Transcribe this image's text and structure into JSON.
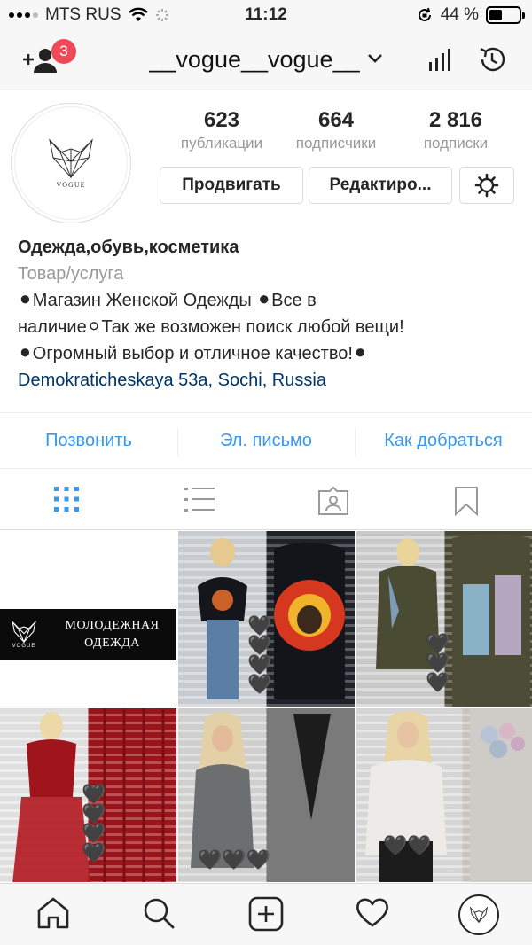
{
  "status_bar": {
    "carrier": "MTS RUS",
    "time": "11:12",
    "battery": "44 %",
    "battery_level": 0.44
  },
  "header": {
    "username": "__vogue__vogue__",
    "follow_badge": "3"
  },
  "profile": {
    "avatar_text": "VOGUE",
    "stats": [
      {
        "value": "623",
        "label": "публикации"
      },
      {
        "value": "664",
        "label": "подписчики"
      },
      {
        "value": "2 816",
        "label": "подписки"
      }
    ],
    "buttons": {
      "promote": "Продвигать",
      "edit": "Редактиро..."
    },
    "bio": {
      "name": "Одежда,обувь,косметика",
      "category": "Товар/услуга",
      "line1": "⚫Магазин Женской Одежды ⚫Все в",
      "line2": "наличие⚪Так же возможен поиск любой вещи!",
      "line3": "⚫Огромный выбор и отличное качество!⚫",
      "location": "Demokraticheskaya 53a, Sochi, Russia"
    }
  },
  "contacts": {
    "call": "Позвонить",
    "email": "Эл. письмо",
    "directions": "Как добраться"
  },
  "grid": {
    "banner_logo": "VOGUE",
    "banner_line1": "МОЛОДЕЖНАЯ",
    "banner_line2": "ОДЕЖДА",
    "heart": "🖤"
  },
  "colors": {
    "accent": "#3897f0",
    "badge": "#ed4956",
    "link": "#003569"
  }
}
